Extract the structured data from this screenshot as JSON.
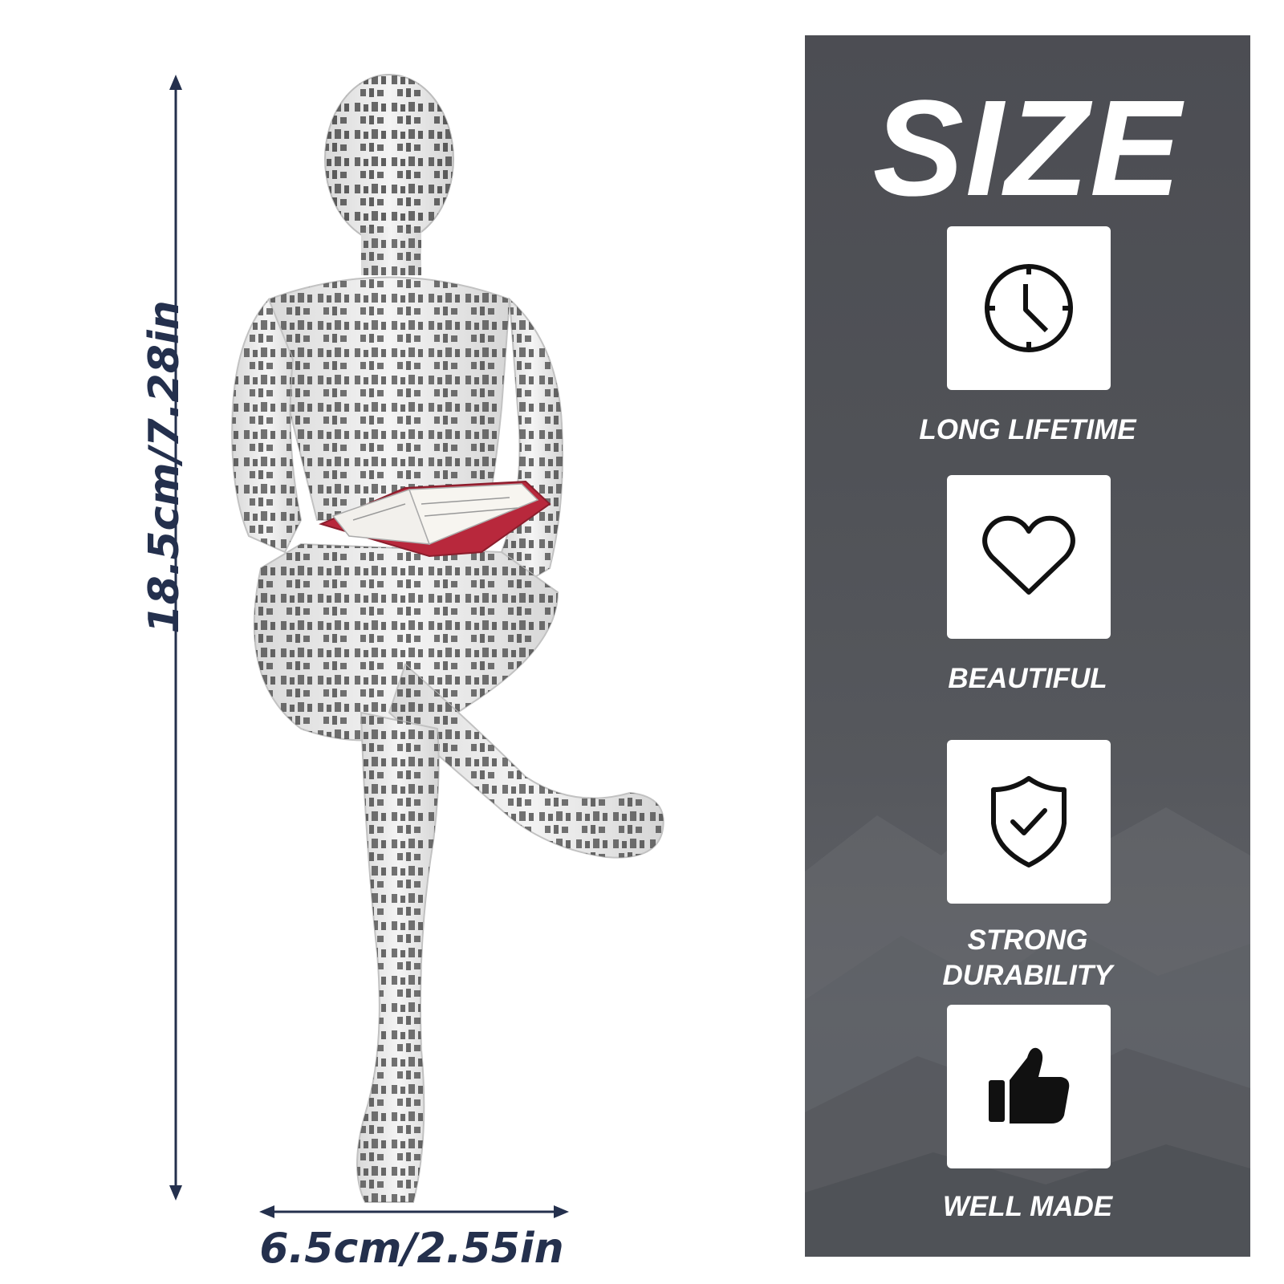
{
  "dimensions": {
    "height_label": "18.5cm/7.28in",
    "width_label": "6.5cm/2.55in"
  },
  "panel": {
    "title": "SIZE",
    "features": [
      {
        "icon": "clock-icon",
        "label": "LONG LIFETIME"
      },
      {
        "icon": "heart-icon",
        "label": "BEAUTIFUL"
      },
      {
        "icon": "shield-check-icon",
        "label": "STRONG DURABILITY"
      },
      {
        "icon": "thumbs-up-icon",
        "label": "WELL MADE"
      }
    ]
  },
  "colors": {
    "dimension": "#24304d",
    "panel_bg": "#505257",
    "text_light": "#ffffff",
    "book_cover": "#b8283c"
  }
}
